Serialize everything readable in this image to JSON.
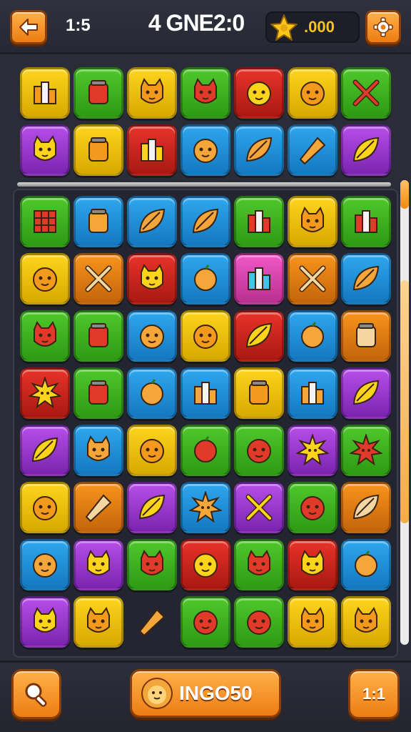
{
  "header": {
    "level": "1:5",
    "title": "4 GNE2:0",
    "score": ".000",
    "back_icon": "arrow-left-icon",
    "settings_icon": "gear-icon",
    "star_icon": "star-icon"
  },
  "colors": {
    "accent": "#f08a12",
    "yellow": "#fcd41c",
    "green": "#4fc72c",
    "blue": "#2ea6ee",
    "red": "#e8332a",
    "purple": "#b64ee8",
    "orange": "#f7941d",
    "pink": "#ef58c8"
  },
  "top_tiles": [
    [
      "yellow",
      "green",
      "yellow",
      "green",
      "red",
      "yellow",
      "green"
    ],
    [
      "purple",
      "yellow",
      "red",
      "blue",
      "blue",
      "blue",
      "purple"
    ]
  ],
  "top_icons": [
    [
      "chart-icon",
      "potion-icon",
      "cat-icon",
      "cat-icon",
      "face-icon",
      "robot-icon",
      "cross-icon"
    ],
    [
      "cat-icon",
      "pot-icon",
      "box-icon",
      "hedgehog-icon",
      "shell-icon",
      "carrot-icon",
      "leaf-icon"
    ]
  ],
  "main_tiles": [
    [
      "green",
      "blue",
      "blue",
      "blue",
      "green",
      "yellow",
      "green"
    ],
    [
      "yellow",
      "orange",
      "red",
      "blue",
      "pink",
      "orange",
      "blue"
    ],
    [
      "green",
      "green",
      "blue",
      "yellow",
      "red",
      "blue",
      "orange"
    ],
    [
      "red",
      "green",
      "blue",
      "blue",
      "yellow",
      "blue",
      "purple"
    ],
    [
      "purple",
      "blue",
      "yellow",
      "green",
      "green",
      "purple",
      "green"
    ],
    [
      "yellow",
      "orange",
      "purple",
      "blue",
      "purple",
      "green",
      "orange"
    ],
    [
      "blue",
      "purple",
      "green",
      "red",
      "green",
      "red",
      "blue"
    ],
    [
      "purple",
      "yellow",
      "none",
      "green",
      "green",
      "yellow",
      "yellow"
    ]
  ],
  "main_icons": [
    [
      "fence-icon",
      "jar-icon",
      "gem-icon",
      "leaf-icon",
      "book-icon",
      "cat-icon",
      "blocks-icon"
    ],
    [
      "ghost-icon",
      "cross-icon",
      "star-face-icon",
      "tomato-icon",
      "file-icon",
      "cross-icon",
      "leaf-icon"
    ],
    [
      "cat-icon",
      "basket-icon",
      "sprout-icon",
      "hedgehog-icon",
      "leaf-icon",
      "berry-icon",
      "bottle-icon"
    ],
    [
      "sun-icon",
      "glass-icon",
      "cherry-icon",
      "blocks-icon",
      "bottle-icon",
      "box-icon",
      "leaf-icon"
    ],
    [
      "fish-icon",
      "cat-icon",
      "face-icon",
      "balloon-icon",
      "ghost-icon",
      "flame-icon",
      "sun-icon"
    ],
    [
      "robot-icon",
      "ice-cream-icon",
      "leaf-icon",
      "sun-icon",
      "cross-icon",
      "face-icon",
      "shell-icon"
    ],
    [
      "face-icon",
      "cat-icon",
      "cat-icon",
      "hedgehog-icon",
      "cat-icon",
      "star-face-icon",
      "drop-icon"
    ],
    [
      "cat-icon",
      "cat-icon",
      "carrot-icon",
      "face-icon",
      "face-icon",
      "fox-icon",
      "fox-icon"
    ]
  ],
  "footer": {
    "hint_icon": "magnifier-icon",
    "bonus_label": "INGO50",
    "bonus_icon": "lion-icon",
    "ratio_label": "1:1"
  }
}
